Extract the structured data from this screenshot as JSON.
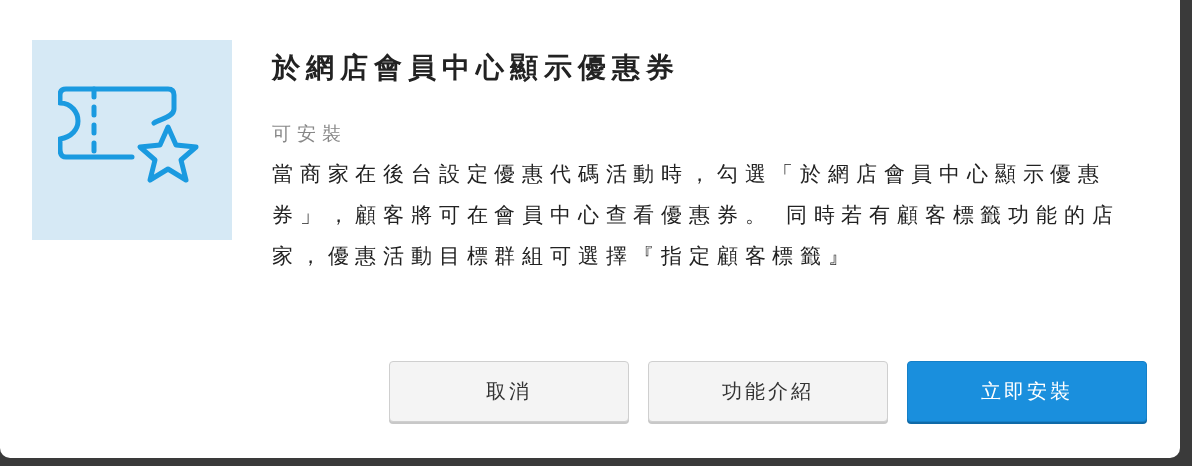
{
  "dialog": {
    "title": "於網店會員中心顯示優惠券",
    "status": "可安裝",
    "description": "當商家在後台設定優惠代碼活動時，勾選「於網店會員中心顯示優惠券」，顧客將可在會員中心查看優惠券。 同時若有顧客標籤功能的店家，優惠活動目標群組可選擇『指定顧客標籤』",
    "buttons": [
      {
        "label": "取消",
        "kind": "secondary"
      },
      {
        "label": "功能介紹",
        "kind": "secondary"
      },
      {
        "label": "立即安裝",
        "kind": "primary"
      }
    ]
  }
}
